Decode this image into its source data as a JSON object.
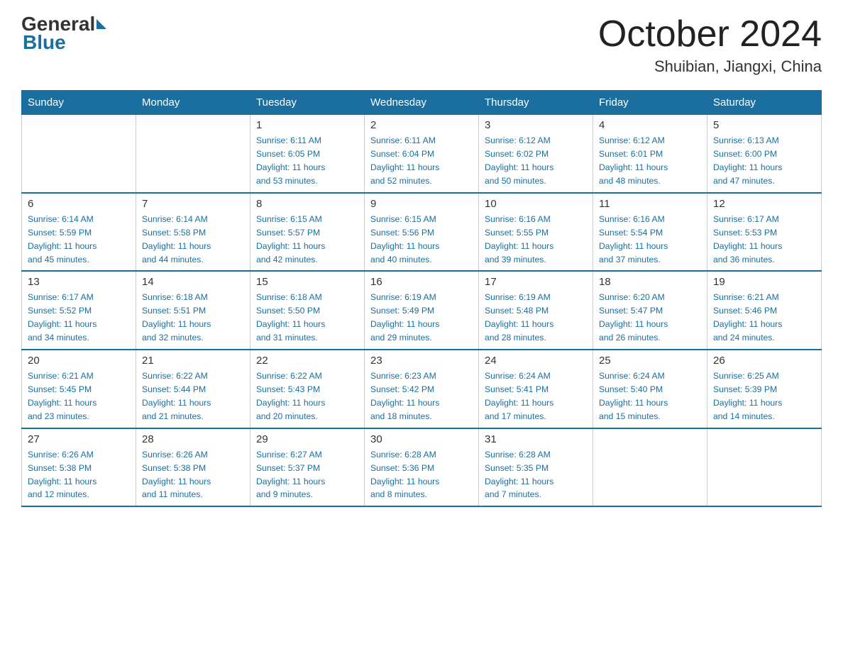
{
  "logo": {
    "general": "General",
    "blue": "Blue"
  },
  "title": "October 2024",
  "subtitle": "Shuibian, Jiangxi, China",
  "days_of_week": [
    "Sunday",
    "Monday",
    "Tuesday",
    "Wednesday",
    "Thursday",
    "Friday",
    "Saturday"
  ],
  "weeks": [
    [
      {
        "num": "",
        "detail": ""
      },
      {
        "num": "",
        "detail": ""
      },
      {
        "num": "1",
        "detail": "Sunrise: 6:11 AM\nSunset: 6:05 PM\nDaylight: 11 hours\nand 53 minutes."
      },
      {
        "num": "2",
        "detail": "Sunrise: 6:11 AM\nSunset: 6:04 PM\nDaylight: 11 hours\nand 52 minutes."
      },
      {
        "num": "3",
        "detail": "Sunrise: 6:12 AM\nSunset: 6:02 PM\nDaylight: 11 hours\nand 50 minutes."
      },
      {
        "num": "4",
        "detail": "Sunrise: 6:12 AM\nSunset: 6:01 PM\nDaylight: 11 hours\nand 48 minutes."
      },
      {
        "num": "5",
        "detail": "Sunrise: 6:13 AM\nSunset: 6:00 PM\nDaylight: 11 hours\nand 47 minutes."
      }
    ],
    [
      {
        "num": "6",
        "detail": "Sunrise: 6:14 AM\nSunset: 5:59 PM\nDaylight: 11 hours\nand 45 minutes."
      },
      {
        "num": "7",
        "detail": "Sunrise: 6:14 AM\nSunset: 5:58 PM\nDaylight: 11 hours\nand 44 minutes."
      },
      {
        "num": "8",
        "detail": "Sunrise: 6:15 AM\nSunset: 5:57 PM\nDaylight: 11 hours\nand 42 minutes."
      },
      {
        "num": "9",
        "detail": "Sunrise: 6:15 AM\nSunset: 5:56 PM\nDaylight: 11 hours\nand 40 minutes."
      },
      {
        "num": "10",
        "detail": "Sunrise: 6:16 AM\nSunset: 5:55 PM\nDaylight: 11 hours\nand 39 minutes."
      },
      {
        "num": "11",
        "detail": "Sunrise: 6:16 AM\nSunset: 5:54 PM\nDaylight: 11 hours\nand 37 minutes."
      },
      {
        "num": "12",
        "detail": "Sunrise: 6:17 AM\nSunset: 5:53 PM\nDaylight: 11 hours\nand 36 minutes."
      }
    ],
    [
      {
        "num": "13",
        "detail": "Sunrise: 6:17 AM\nSunset: 5:52 PM\nDaylight: 11 hours\nand 34 minutes."
      },
      {
        "num": "14",
        "detail": "Sunrise: 6:18 AM\nSunset: 5:51 PM\nDaylight: 11 hours\nand 32 minutes."
      },
      {
        "num": "15",
        "detail": "Sunrise: 6:18 AM\nSunset: 5:50 PM\nDaylight: 11 hours\nand 31 minutes."
      },
      {
        "num": "16",
        "detail": "Sunrise: 6:19 AM\nSunset: 5:49 PM\nDaylight: 11 hours\nand 29 minutes."
      },
      {
        "num": "17",
        "detail": "Sunrise: 6:19 AM\nSunset: 5:48 PM\nDaylight: 11 hours\nand 28 minutes."
      },
      {
        "num": "18",
        "detail": "Sunrise: 6:20 AM\nSunset: 5:47 PM\nDaylight: 11 hours\nand 26 minutes."
      },
      {
        "num": "19",
        "detail": "Sunrise: 6:21 AM\nSunset: 5:46 PM\nDaylight: 11 hours\nand 24 minutes."
      }
    ],
    [
      {
        "num": "20",
        "detail": "Sunrise: 6:21 AM\nSunset: 5:45 PM\nDaylight: 11 hours\nand 23 minutes."
      },
      {
        "num": "21",
        "detail": "Sunrise: 6:22 AM\nSunset: 5:44 PM\nDaylight: 11 hours\nand 21 minutes."
      },
      {
        "num": "22",
        "detail": "Sunrise: 6:22 AM\nSunset: 5:43 PM\nDaylight: 11 hours\nand 20 minutes."
      },
      {
        "num": "23",
        "detail": "Sunrise: 6:23 AM\nSunset: 5:42 PM\nDaylight: 11 hours\nand 18 minutes."
      },
      {
        "num": "24",
        "detail": "Sunrise: 6:24 AM\nSunset: 5:41 PM\nDaylight: 11 hours\nand 17 minutes."
      },
      {
        "num": "25",
        "detail": "Sunrise: 6:24 AM\nSunset: 5:40 PM\nDaylight: 11 hours\nand 15 minutes."
      },
      {
        "num": "26",
        "detail": "Sunrise: 6:25 AM\nSunset: 5:39 PM\nDaylight: 11 hours\nand 14 minutes."
      }
    ],
    [
      {
        "num": "27",
        "detail": "Sunrise: 6:26 AM\nSunset: 5:38 PM\nDaylight: 11 hours\nand 12 minutes."
      },
      {
        "num": "28",
        "detail": "Sunrise: 6:26 AM\nSunset: 5:38 PM\nDaylight: 11 hours\nand 11 minutes."
      },
      {
        "num": "29",
        "detail": "Sunrise: 6:27 AM\nSunset: 5:37 PM\nDaylight: 11 hours\nand 9 minutes."
      },
      {
        "num": "30",
        "detail": "Sunrise: 6:28 AM\nSunset: 5:36 PM\nDaylight: 11 hours\nand 8 minutes."
      },
      {
        "num": "31",
        "detail": "Sunrise: 6:28 AM\nSunset: 5:35 PM\nDaylight: 11 hours\nand 7 minutes."
      },
      {
        "num": "",
        "detail": ""
      },
      {
        "num": "",
        "detail": ""
      }
    ]
  ]
}
